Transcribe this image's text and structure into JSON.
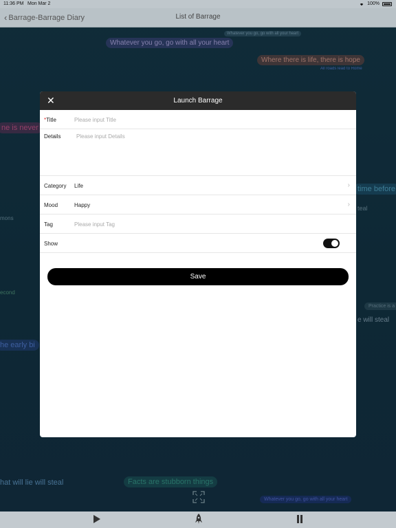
{
  "status_bar": {
    "time": "11:36 PM",
    "date": "Mon Mar 2",
    "battery": "100%"
  },
  "nav": {
    "back_label": "Barrage-Barrage Diary",
    "title": "List of Barrage"
  },
  "barrages": [
    {
      "text": "Whatever you go, go with all your heart",
      "color": "#b89af0"
    },
    {
      "text": "Whatever you go, go with all your heart",
      "color": "#7fa8c0"
    },
    {
      "text": "Where there is life, there is hope",
      "color": "#e08a6a"
    },
    {
      "text": "All roads lead to Rome",
      "color": "#4f7fd0"
    },
    {
      "text": "ne is never",
      "color": "#e0508a"
    },
    {
      "text": "time before",
      "color": "#40a0c0"
    },
    {
      "text": "teal",
      "color": "#7f9aa8"
    },
    {
      "text": "mons",
      "color": "#7a9aa8"
    },
    {
      "text": "econd",
      "color": "#5aa07a"
    },
    {
      "text": "Practice is a",
      "color": "#6a8a9a"
    },
    {
      "text": "e will steal",
      "color": "#9ab0c0"
    },
    {
      "text": "he early bi",
      "color": "#4f7fd0"
    },
    {
      "text": "hat will lie will steal",
      "color": "#6aa0d0"
    },
    {
      "text": "Facts are stubborn things",
      "color": "#3aa08a"
    },
    {
      "text": "Whatever you go, go with all your heart",
      "color": "#4050d0"
    }
  ],
  "modal": {
    "close_icon": "close-icon",
    "title": "Launch Barrage",
    "title_field": {
      "required_mark": "*",
      "label": "Title",
      "placeholder": "Please input Title"
    },
    "details_field": {
      "label": "Details",
      "placeholder": "Please input Details"
    },
    "category": {
      "label": "Category",
      "value": "Life"
    },
    "mood": {
      "label": "Mood",
      "value": "Happy"
    },
    "tag_field": {
      "label": "Tag",
      "placeholder": "Please input Tag"
    },
    "show": {
      "label": "Show",
      "on": true
    },
    "save_label": "Save"
  },
  "bottom_bar": {
    "play_icon": "play-icon",
    "rocket_icon": "rocket-icon",
    "pause_icon": "pause-icon"
  }
}
